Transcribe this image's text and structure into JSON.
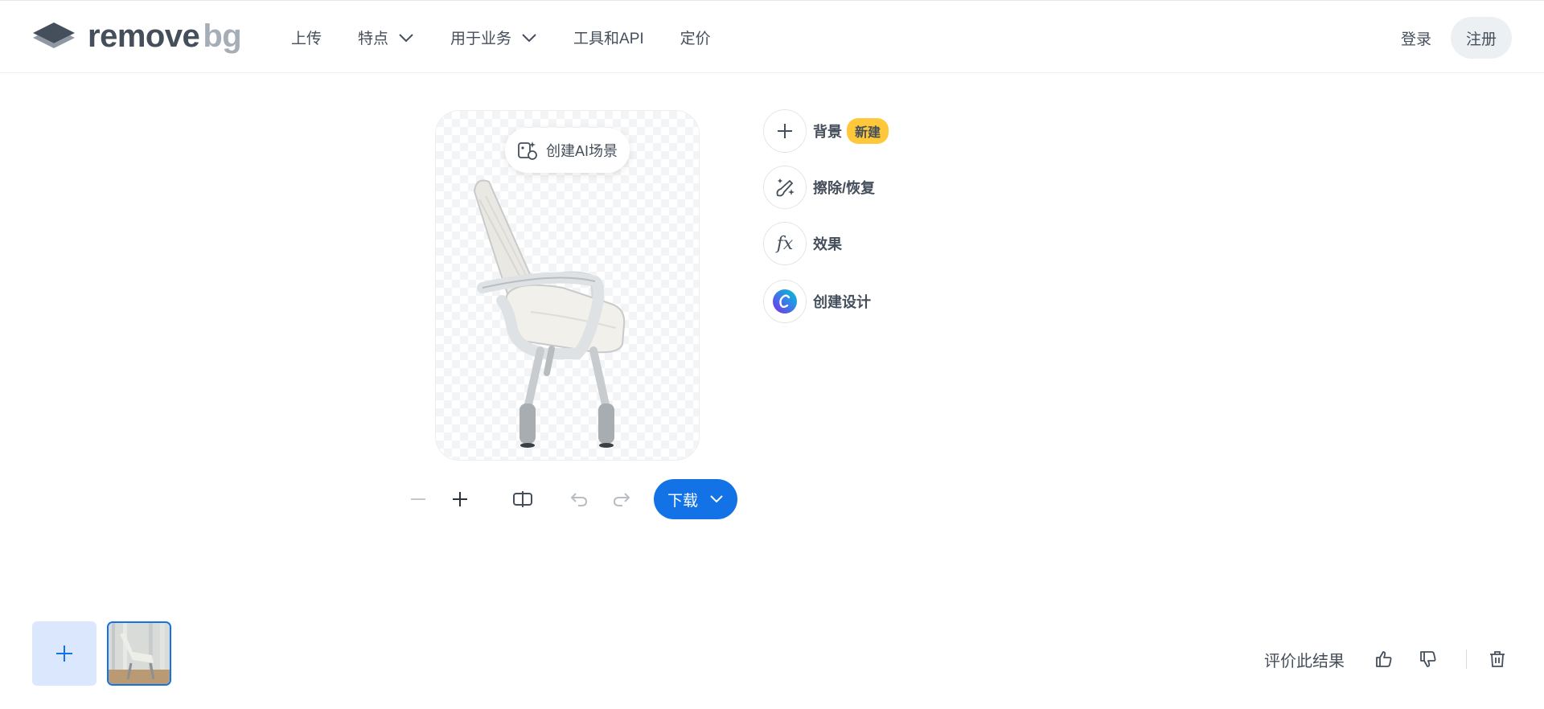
{
  "brand": {
    "word1": "remove",
    "word2": "bg"
  },
  "nav": {
    "items": [
      {
        "label": "上传",
        "has_dropdown": false
      },
      {
        "label": "特点",
        "has_dropdown": true
      },
      {
        "label": "用于业务",
        "has_dropdown": true
      },
      {
        "label": "工具和API",
        "has_dropdown": false
      },
      {
        "label": "定价",
        "has_dropdown": false
      }
    ],
    "login": "登录",
    "signup": "注册"
  },
  "editor": {
    "ai_scene_button": "创建AI场景",
    "tools": [
      {
        "label": "背景",
        "badge": "新建",
        "icon": "plus-icon"
      },
      {
        "label": "擦除/恢复",
        "icon": "magic-brush-icon"
      },
      {
        "label": "效果",
        "icon": "fx-icon"
      },
      {
        "label": "创建设计",
        "icon": "canva-logo-icon"
      }
    ],
    "download_label": "下载"
  },
  "bottom": {
    "rate_label": "评价此结果"
  },
  "colors": {
    "accent": "#1373e6",
    "badge": "#ffc73a",
    "text": "#454f5b"
  }
}
